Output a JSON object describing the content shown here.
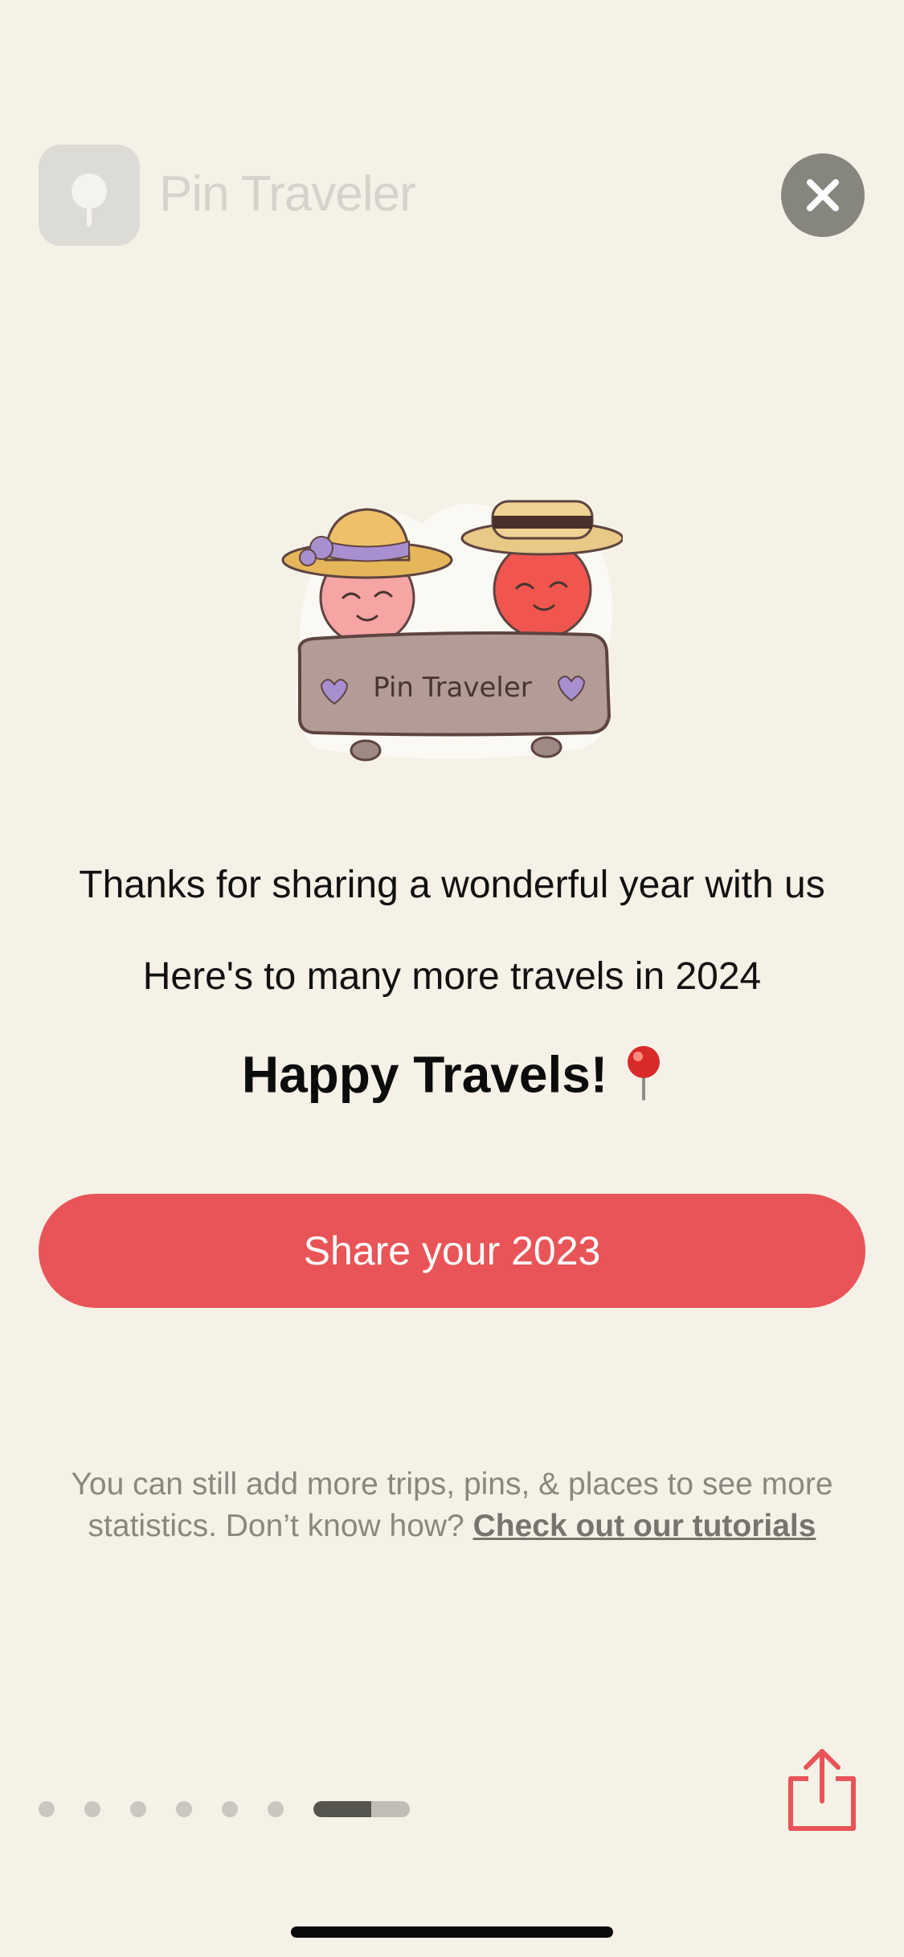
{
  "header": {
    "app_name": "Pin Traveler",
    "logo_icon": "pin-logo-icon",
    "close_icon": "close-icon"
  },
  "illustration": {
    "sign_text": "Pin Traveler"
  },
  "message": {
    "thanks": "Thanks for sharing a wonderful year with us",
    "next_year": "Here's to many more travels in 2024",
    "happy_travels": "Happy Travels!",
    "pin_emoji_icon": "round-pushpin-icon"
  },
  "share_button": {
    "label": "Share your 2023"
  },
  "footer": {
    "note": "You can still add more trips, pins, & places to see more statistics. Don’t know how? ",
    "link": "Check out our tutorials"
  },
  "pagination": {
    "total_pages": 7,
    "current_page": 7,
    "current_page_progress": 0.6
  },
  "share_icon": "share-icon",
  "colors": {
    "background": "#f5f1e7",
    "accent": "#e85457",
    "close_button": "#86867f"
  }
}
